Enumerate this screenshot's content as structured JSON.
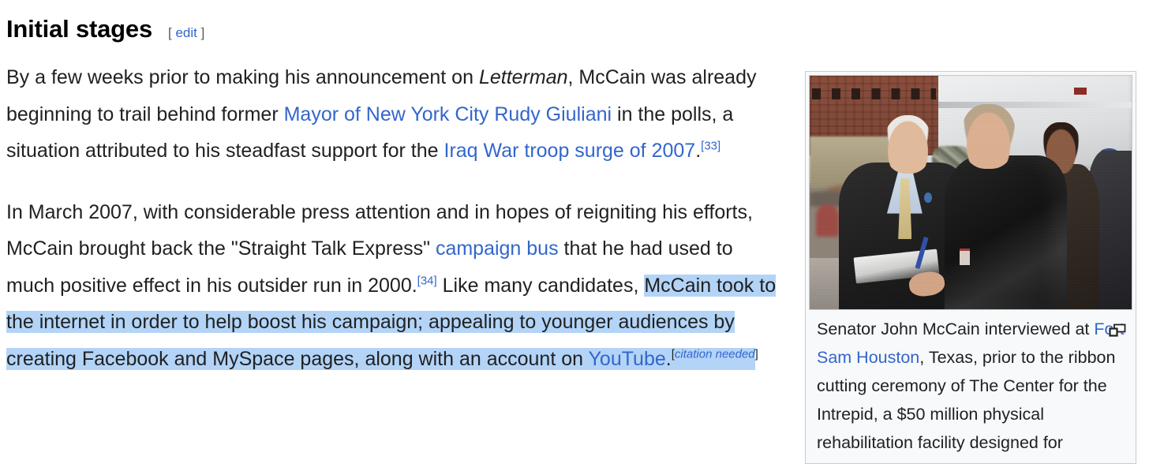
{
  "section": {
    "heading": "Initial stages",
    "edit": {
      "open_bracket": "[",
      "label": "edit",
      "close_bracket": "]"
    }
  },
  "paragraphs": {
    "p1": {
      "t1": "By a few weeks prior to making his announcement on ",
      "italic_letterman": "Letterman",
      "t2": ", McCain was already beginning to trail behind former ",
      "link_giuliani": "Mayor of New York City Rudy Giuliani",
      "t3": " in the polls, a situation attributed to his steadfast support for the ",
      "link_surge": "Iraq War troop surge of 2007",
      "t4": ".",
      "ref1": "[33]"
    },
    "p2": {
      "t1": "In March 2007, with considerable press attention and in hopes of reigniting his efforts, McCain brought back the \"Straight Talk Express\" ",
      "link_campaign_bus": "campaign bus",
      "t2": " that he had used to much positive effect in his outsider run in 2000.",
      "ref2": "[34]",
      "t3": " Like many candidates, ",
      "selected_t1": "McCain took to the internet in order to help boost his campaign; appealing to younger audiences by creating Facebook and MySpace pages, along with an account on ",
      "selected_link_youtube": "YouTube",
      "selected_t2": ".",
      "cn_open": "[",
      "cn_label": "citation needed",
      "cn_close": "]"
    }
  },
  "figure": {
    "image_alt": "Senator John McCain interviewed at Fort Sam Houston",
    "magnify_icon": "enlarge-icon",
    "caption": {
      "t1": "Senator John McCain interviewed at ",
      "link_fort_sam": "Fort Sam Houston",
      "t2": ", Texas, prior to the ribbon cutting ceremony of The Center for the Intrepid, a $50 million physical rehabilitation facility designed for"
    }
  },
  "colors": {
    "link": "#3366cc",
    "text": "#202122",
    "selection_highlight": "#b3d4f7",
    "thumb_border": "#c8ccd1",
    "thumb_background": "#f8f9fa"
  }
}
